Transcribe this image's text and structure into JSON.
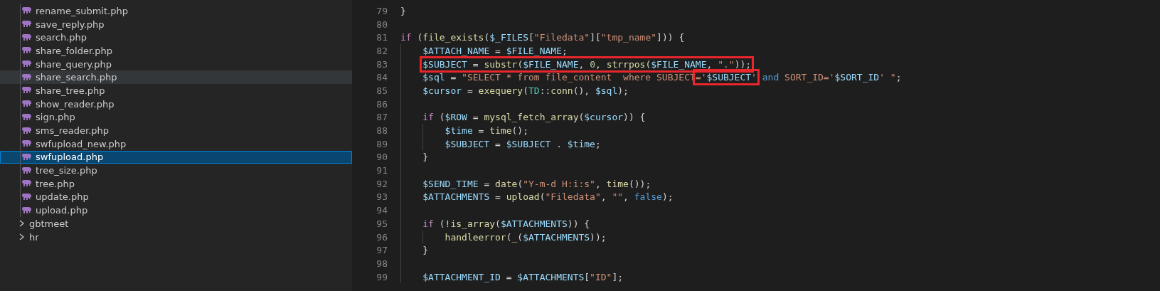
{
  "explorer": {
    "items": [
      {
        "kind": "file",
        "label": "rename_submit.php",
        "selected": false,
        "hovered": false
      },
      {
        "kind": "file",
        "label": "save_reply.php",
        "selected": false,
        "hovered": false
      },
      {
        "kind": "file",
        "label": "search.php",
        "selected": false,
        "hovered": false
      },
      {
        "kind": "file",
        "label": "share_folder.php",
        "selected": false,
        "hovered": false
      },
      {
        "kind": "file",
        "label": "share_query.php",
        "selected": false,
        "hovered": false
      },
      {
        "kind": "file",
        "label": "share_search.php",
        "selected": false,
        "hovered": true
      },
      {
        "kind": "file",
        "label": "share_tree.php",
        "selected": false,
        "hovered": false
      },
      {
        "kind": "file",
        "label": "show_reader.php",
        "selected": false,
        "hovered": false
      },
      {
        "kind": "file",
        "label": "sign.php",
        "selected": false,
        "hovered": false
      },
      {
        "kind": "file",
        "label": "sms_reader.php",
        "selected": false,
        "hovered": false
      },
      {
        "kind": "file",
        "label": "swfupload_new.php",
        "selected": false,
        "hovered": false
      },
      {
        "kind": "file",
        "label": "swfupload.php",
        "selected": true,
        "hovered": false
      },
      {
        "kind": "file",
        "label": "tree_size.php",
        "selected": false,
        "hovered": false
      },
      {
        "kind": "file",
        "label": "tree.php",
        "selected": false,
        "hovered": false
      },
      {
        "kind": "file",
        "label": "update.php",
        "selected": false,
        "hovered": false
      },
      {
        "kind": "file",
        "label": "upload.php",
        "selected": false,
        "hovered": false
      },
      {
        "kind": "folder",
        "label": "gbtmeet",
        "selected": false,
        "hovered": false
      },
      {
        "kind": "folder",
        "label": "hr",
        "selected": false,
        "hovered": false
      }
    ]
  },
  "editor": {
    "lines": [
      {
        "number": "79",
        "tokens": [
          {
            "text": "}",
            "kind": "punct"
          }
        ]
      },
      {
        "number": "80"
      },
      {
        "number": "81",
        "tokens": [
          {
            "text": "if",
            "kind": "keyword"
          },
          {
            "text": " (",
            "kind": "punct"
          },
          {
            "text": "file_exists",
            "kind": "function"
          },
          {
            "text": "(",
            "kind": "punct"
          },
          {
            "text": "$_FILES",
            "kind": "variable"
          },
          {
            "text": "[",
            "kind": "punct"
          },
          {
            "text": "\"Filedata\"",
            "kind": "string"
          },
          {
            "text": "][",
            "kind": "punct"
          },
          {
            "text": "\"tmp_name\"",
            "kind": "string"
          },
          {
            "text": "])) {",
            "kind": "punct"
          }
        ],
        "children": [
          {
            "number": "82",
            "tokens": [
              {
                "text": "$ATTACH_NAME",
                "kind": "variable"
              },
              {
                "text": " = ",
                "kind": "punct"
              },
              {
                "text": "$FILE_NAME",
                "kind": "variable"
              },
              {
                "text": ";",
                "kind": "punct"
              }
            ]
          },
          {
            "number": "83",
            "tokens": [
              {
                "kind": "box",
                "tokens": [
                  {
                    "text": "$SUBJECT",
                    "kind": "variable"
                  },
                  {
                    "text": " = ",
                    "kind": "punct"
                  },
                  {
                    "text": "substr",
                    "kind": "function"
                  },
                  {
                    "text": "(",
                    "kind": "punct"
                  },
                  {
                    "text": "$FILE_NAME",
                    "kind": "variable"
                  },
                  {
                    "text": ", ",
                    "kind": "punct"
                  },
                  {
                    "text": "0",
                    "kind": "number"
                  },
                  {
                    "text": ", ",
                    "kind": "punct"
                  },
                  {
                    "text": "strrpos",
                    "kind": "function"
                  },
                  {
                    "text": "(",
                    "kind": "punct"
                  },
                  {
                    "text": "$FILE_NAME",
                    "kind": "variable"
                  },
                  {
                    "text": ", ",
                    "kind": "punct"
                  },
                  {
                    "text": "\".\"",
                    "kind": "string"
                  },
                  {
                    "text": "));",
                    "kind": "punct"
                  }
                ]
              }
            ]
          },
          {
            "number": "84",
            "tokens": [
              {
                "text": "$sql",
                "kind": "variable"
              },
              {
                "text": " = ",
                "kind": "punct"
              },
              {
                "text": "\"SELECT * from file_content  where SUBJECT",
                "kind": "string"
              },
              {
                "kind": "box",
                "tokens": [
                  {
                    "text": "='",
                    "kind": "string"
                  },
                  {
                    "text": "$SUBJECT",
                    "kind": "variable"
                  },
                  {
                    "text": "'",
                    "kind": "string"
                  }
                ]
              },
              {
                "text": " and",
                "kind": "constant"
              },
              {
                "text": " SORT_ID='",
                "kind": "string"
              },
              {
                "text": "$SORT_ID",
                "kind": "variable"
              },
              {
                "text": "' \"",
                "kind": "string"
              },
              {
                "text": ";",
                "kind": "punct"
              }
            ]
          },
          {
            "number": "85",
            "tokens": [
              {
                "text": "$cursor",
                "kind": "variable"
              },
              {
                "text": " = ",
                "kind": "punct"
              },
              {
                "text": "exequery",
                "kind": "function"
              },
              {
                "text": "(",
                "kind": "punct"
              },
              {
                "text": "TD",
                "kind": "class"
              },
              {
                "text": "::",
                "kind": "punct"
              },
              {
                "text": "conn",
                "kind": "function"
              },
              {
                "text": "(), ",
                "kind": "punct"
              },
              {
                "text": "$sql",
                "kind": "variable"
              },
              {
                "text": ");",
                "kind": "punct"
              }
            ]
          },
          {
            "number": "86"
          },
          {
            "number": "87",
            "tokens": [
              {
                "text": "if",
                "kind": "keyword"
              },
              {
                "text": " (",
                "kind": "punct"
              },
              {
                "text": "$ROW",
                "kind": "variable"
              },
              {
                "text": " = ",
                "kind": "punct"
              },
              {
                "text": "mysql_fetch_array",
                "kind": "function"
              },
              {
                "text": "(",
                "kind": "punct"
              },
              {
                "text": "$cursor",
                "kind": "variable"
              },
              {
                "text": ")) {",
                "kind": "punct"
              }
            ],
            "children": [
              {
                "number": "88",
                "tokens": [
                  {
                    "text": "$time",
                    "kind": "variable"
                  },
                  {
                    "text": " = ",
                    "kind": "punct"
                  },
                  {
                    "text": "time",
                    "kind": "function"
                  },
                  {
                    "text": "();",
                    "kind": "punct"
                  }
                ]
              },
              {
                "number": "89",
                "tokens": [
                  {
                    "text": "$SUBJECT",
                    "kind": "variable"
                  },
                  {
                    "text": " = ",
                    "kind": "punct"
                  },
                  {
                    "text": "$SUBJECT",
                    "kind": "variable"
                  },
                  {
                    "text": " . ",
                    "kind": "punct"
                  },
                  {
                    "text": "$time",
                    "kind": "variable"
                  },
                  {
                    "text": ";",
                    "kind": "punct"
                  }
                ]
              }
            ]
          },
          {
            "number": "90",
            "tokens": [
              {
                "text": "}",
                "kind": "punct"
              }
            ]
          },
          {
            "number": "91"
          },
          {
            "number": "92",
            "tokens": [
              {
                "text": "$SEND_TIME",
                "kind": "variable"
              },
              {
                "text": " = ",
                "kind": "punct"
              },
              {
                "text": "date",
                "kind": "function"
              },
              {
                "text": "(",
                "kind": "punct"
              },
              {
                "text": "\"Y-m-d H:i:s\"",
                "kind": "string"
              },
              {
                "text": ", ",
                "kind": "punct"
              },
              {
                "text": "time",
                "kind": "function"
              },
              {
                "text": "());",
                "kind": "punct"
              }
            ]
          },
          {
            "number": "93",
            "tokens": [
              {
                "text": "$ATTACHMENTS",
                "kind": "variable"
              },
              {
                "text": " = ",
                "kind": "punct"
              },
              {
                "text": "upload",
                "kind": "function"
              },
              {
                "text": "(",
                "kind": "punct"
              },
              {
                "text": "\"Filedata\"",
                "kind": "string"
              },
              {
                "text": ", ",
                "kind": "punct"
              },
              {
                "text": "\"\"",
                "kind": "string"
              },
              {
                "text": ", ",
                "kind": "punct"
              },
              {
                "text": "false",
                "kind": "constant"
              },
              {
                "text": ");",
                "kind": "punct"
              }
            ]
          },
          {
            "number": "94"
          },
          {
            "number": "95",
            "tokens": [
              {
                "text": "if",
                "kind": "keyword"
              },
              {
                "text": " (!",
                "kind": "punct"
              },
              {
                "text": "is_array",
                "kind": "function"
              },
              {
                "text": "(",
                "kind": "punct"
              },
              {
                "text": "$ATTACHMENTS",
                "kind": "variable"
              },
              {
                "text": ")) {",
                "kind": "punct"
              }
            ],
            "children": [
              {
                "number": "96",
                "tokens": [
                  {
                    "text": "handleerror",
                    "kind": "function"
                  },
                  {
                    "text": "(",
                    "kind": "punct"
                  },
                  {
                    "text": "_",
                    "kind": "function"
                  },
                  {
                    "text": "(",
                    "kind": "punct"
                  },
                  {
                    "text": "$ATTACHMENTS",
                    "kind": "variable"
                  },
                  {
                    "text": "));",
                    "kind": "punct"
                  }
                ]
              }
            ]
          },
          {
            "number": "97",
            "tokens": [
              {
                "text": "}",
                "kind": "punct"
              }
            ]
          },
          {
            "number": "98"
          },
          {
            "number": "99",
            "tokens": [
              {
                "text": "$ATTACHMENT_ID",
                "kind": "variable"
              },
              {
                "text": " = ",
                "kind": "punct"
              },
              {
                "text": "$ATTACHMENTS",
                "kind": "variable"
              },
              {
                "text": "[",
                "kind": "punct"
              },
              {
                "text": "\"ID\"",
                "kind": "string"
              },
              {
                "text": "];",
                "kind": "punct"
              }
            ]
          }
        ]
      }
    ]
  }
}
